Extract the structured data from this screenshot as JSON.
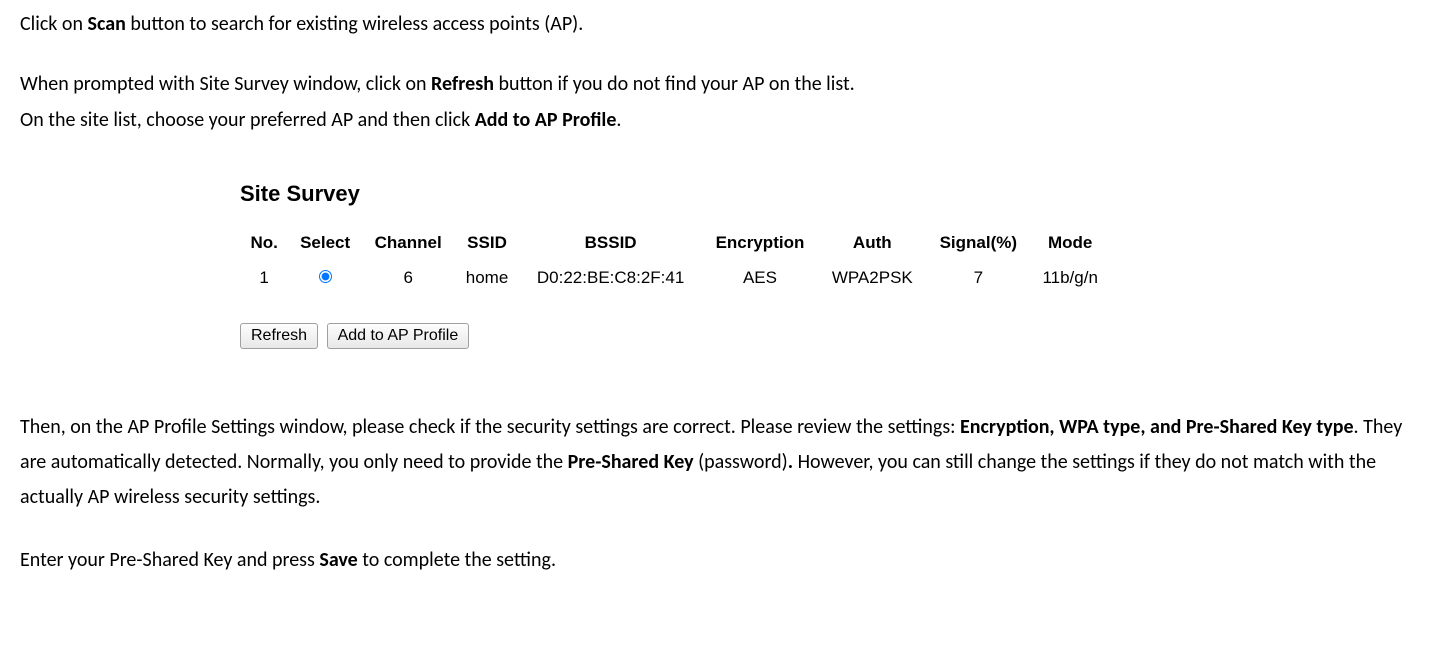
{
  "intro": {
    "p1_pre": "Click on ",
    "p1_bold": "Scan",
    "p1_post": " button to search for existing wireless access points (AP).",
    "p2_pre": "When prompted with Site Survey window, click on ",
    "p2_bold": "Refresh",
    "p2_post": " button if you do not find your AP on the list.",
    "p3_pre": "On the site list, choose your preferred AP and then click ",
    "p3_bold": "Add to AP Profile",
    "p3_post": "."
  },
  "site_survey": {
    "title": "Site Survey",
    "headers": {
      "no": "No.",
      "select": "Select",
      "channel": "Channel",
      "ssid": "SSID",
      "bssid": "BSSID",
      "encryption": "Encryption",
      "auth": "Auth",
      "signal": "Signal(%)",
      "mode": "Mode"
    },
    "rows": [
      {
        "no": "1",
        "channel": "6",
        "ssid": "home",
        "bssid": "D0:22:BE:C8:2F:41",
        "encryption": "AES",
        "auth": "WPA2PSK",
        "signal": "7",
        "mode": "11b/g/n"
      }
    ],
    "buttons": {
      "refresh": "Refresh",
      "add": "Add to AP Profile"
    }
  },
  "after": {
    "p4_pre": "Then, on the AP Profile Settings window, please check if the security settings are correct. Please review the settings: ",
    "p4_bold1": "Encryption, WPA type, and Pre-Shared Key type",
    "p4_mid1": ". They are automatically detected. Normally, you only need to provide the ",
    "p4_bold2": "Pre-Shared Key",
    "p4_mid2": " (password)",
    "p4_bold3": ".",
    "p4_post": " However, you can still change the settings if they do not match with the actually AP wireless security settings.",
    "p5_pre": "Enter your Pre-Shared Key and press ",
    "p5_bold": "Save",
    "p5_post": " to complete the setting."
  }
}
